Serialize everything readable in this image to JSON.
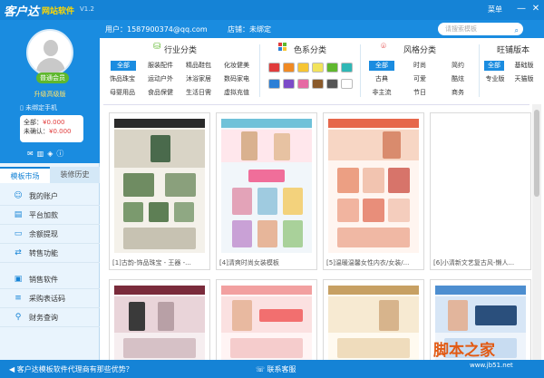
{
  "titlebar": {
    "logo": "客户达",
    "product": "网站软件",
    "version": "V1.2",
    "menu": "菜单",
    "minimize": "—",
    "close": "✕"
  },
  "subheader": {
    "user": "用户：1587900374@qq.com",
    "shop": "店铺：未绑定",
    "search_placeholder": "请搜索模板"
  },
  "sidebar": {
    "vip_badge": "普通会员",
    "vip_label": "升级高级版",
    "bind_phone": "未绑定手机",
    "balance_total_label": "全部：",
    "balance_total": "¥0.000",
    "balance_unconfirmed_label": "未确认：",
    "balance_unconfirmed": "¥0.000",
    "tabs": [
      "模板市场",
      "装修历史"
    ],
    "nav": [
      "我的账户",
      "平台加款",
      "余额提现",
      "转售功能",
      "销售软件",
      "采购表话码",
      "财务查询"
    ]
  },
  "filters": {
    "industry": {
      "title": "行业分类",
      "items": [
        "全部",
        "服装配件",
        "精品鞋包",
        "化妆健美",
        "饰品珠宝",
        "运动户外",
        "沐浴家居",
        "数码家电",
        "母婴用品",
        "食品保健",
        "生活日需",
        "虚拟充值"
      ]
    },
    "color": {
      "title": "色系分类"
    },
    "style": {
      "title": "风格分类",
      "items": [
        "全部",
        "时尚",
        "简约",
        "古典",
        "可爱",
        "酷炫",
        "非主流",
        "节日",
        "商务"
      ]
    },
    "edition": {
      "title": "旺铺版本",
      "items": [
        "全部",
        "基础版",
        "专业版",
        "天猫版"
      ]
    }
  },
  "colors": {
    "accent": "#1583d6",
    "swatches": [
      "#e03c3c",
      "#f08a24",
      "#f6c533",
      "#f2e35b",
      "#5fb82e",
      "#2fb7b5",
      "#2c7fd6",
      "#7c4bc8",
      "#e66aa3",
      "#8a5a2b",
      "#555555",
      "#ffffff"
    ]
  },
  "templates": [
    {
      "caption": "[1]古韵-饰品珠宝 - 王器 -..."
    },
    {
      "caption": "[4]清爽时尚女装模板"
    },
    {
      "caption": "[5]温暖温馨女性内衣/女装/..."
    },
    {
      "caption": "[6]小清新文艺复古风-懒人..."
    },
    {
      "caption": ""
    },
    {
      "caption": ""
    },
    {
      "caption": ""
    },
    {
      "caption": ""
    }
  ],
  "footer": {
    "notice": "客户达模板软件代理商有那些优势？",
    "contact": "联系客服"
  },
  "watermark": {
    "text": "脚本之家",
    "url": "www.jb51.net"
  }
}
